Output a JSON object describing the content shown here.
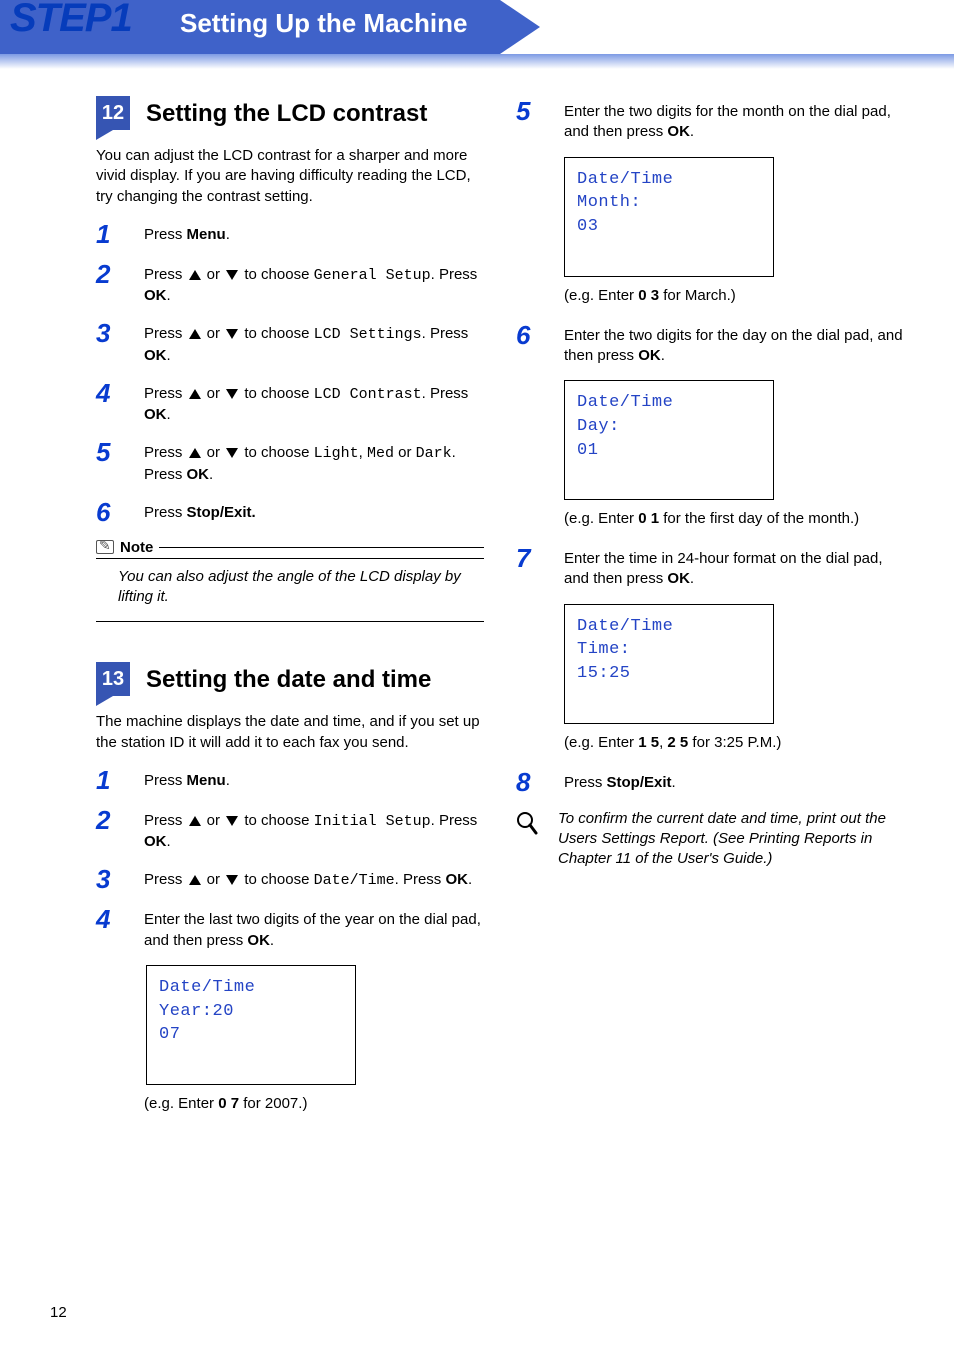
{
  "banner": {
    "step_label": "STEP1",
    "title": "Setting Up the Machine"
  },
  "section12": {
    "num": "12",
    "title": "Setting the LCD contrast",
    "intro": "You can adjust the LCD contrast for a sharper and more vivid display. If you are having difficulty reading the LCD, try changing the contrast setting.",
    "steps": {
      "s1": {
        "num": "1",
        "prefix": "Press ",
        "bold": "Menu",
        "suffix": "."
      },
      "s2": {
        "num": "2",
        "prefix": "Press ",
        "mid": " or ",
        "suffix": " to choose ",
        "code": "General Setup",
        "tail": ". Press ",
        "bold2": "OK",
        "end": "."
      },
      "s3": {
        "num": "3",
        "code": "LCD Settings"
      },
      "s4": {
        "num": "4",
        "code": "LCD Contrast"
      },
      "s5": {
        "num": "5",
        "pre": "Press ",
        "mid": " or ",
        "suf1": " to choose ",
        "c1": "Light",
        "comma": ", ",
        "c2": "Med",
        "or": " or ",
        "c3": "Dark",
        "tail": ". Press ",
        "bold2": "OK",
        "end": "."
      },
      "s6": {
        "num": "6",
        "prefix": "Press ",
        "bold": "Stop/Exit.",
        "suffix": ""
      }
    },
    "note": {
      "label": "Note",
      "body": "You can also adjust the angle of the LCD display by lifting it."
    }
  },
  "section13": {
    "num": "13",
    "title": "Setting the date and time",
    "intro": "The machine displays the date and time, and if you set up the station ID it will add it to each fax you send.",
    "left_steps": {
      "s1": {
        "num": "1",
        "prefix": "Press ",
        "bold": "Menu",
        "suffix": "."
      },
      "s2": {
        "num": "2",
        "code": "Initial Setup"
      },
      "s3": {
        "num": "3",
        "code": "Date/Time"
      },
      "s4": {
        "num": "4",
        "text_a": "Enter the last two digits of the year on the dial pad, and then press ",
        "bold": "OK",
        "text_b": "."
      }
    },
    "lcd_year": {
      "l1": "Date/Time",
      "l2": "Year:20",
      "l3": "07"
    },
    "eg_year_a": "(e.g. Enter ",
    "eg_year_b": "0 7",
    "eg_year_c": " for 2007.)"
  },
  "right": {
    "s5": {
      "num": "5",
      "text_a": "Enter the two digits for the month on the dial pad, and then press ",
      "bold": "OK",
      "text_b": "."
    },
    "lcd_month": {
      "l1": "Date/Time",
      "l2": "Month:",
      "l3": "03"
    },
    "eg_month_a": "(e.g. Enter ",
    "eg_month_b": "0 3",
    "eg_month_c": " for March.)",
    "s6": {
      "num": "6",
      "text_a": "Enter the two digits for the day on the dial pad, and then press ",
      "bold": "OK",
      "text_b": "."
    },
    "lcd_day": {
      "l1": "Date/Time",
      "l2": "Day:",
      "l3": "01"
    },
    "eg_day_a": "(e.g. Enter ",
    "eg_day_b": "0 1",
    "eg_day_c": " for the first day of the month.)",
    "s7": {
      "num": "7",
      "text_a": "Enter the time in 24-hour format on the dial pad, and then press ",
      "bold": "OK",
      "text_b": "."
    },
    "lcd_time": {
      "l1": "Date/Time",
      "l2": "Time:",
      "l3": "15:25"
    },
    "eg_time_a": "(e.g. Enter ",
    "eg_time_b1": "1 5",
    "eg_time_mid": ", ",
    "eg_time_b2": "2 5",
    "eg_time_c": " for 3:25 P.M.)",
    "s8": {
      "num": "8",
      "prefix": "Press ",
      "bold": "Stop/Exit",
      "suffix": "."
    },
    "tip": "To confirm the current date and time, print out the Users Settings Report. (See Printing Reports in Chapter 11 of the User's Guide.)"
  },
  "page_number": "12"
}
